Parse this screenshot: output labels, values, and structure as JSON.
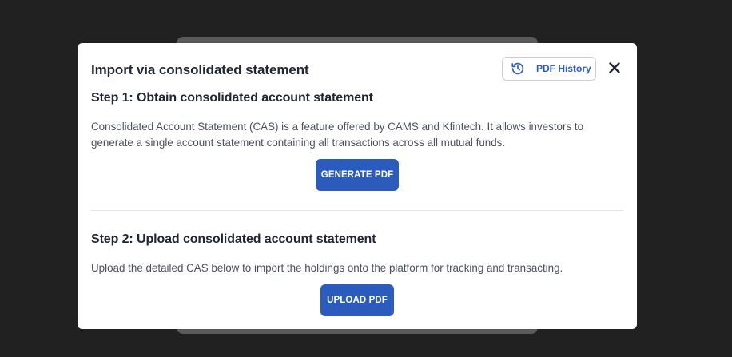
{
  "modal": {
    "title": "Import via consolidated statement",
    "history_button_label": "PDF History",
    "history_icon": "history-icon",
    "close_icon": "close-icon"
  },
  "step1": {
    "title": "Step 1: Obtain consolidated account statement",
    "description": "Consolidated Account Statement (CAS) is a feature offered by CAMS and Kfintech. It allows investors to generate a single account statement containing all transactions across all mutual funds.",
    "button_label": "GENERATE PDF"
  },
  "step2": {
    "title": "Step 2: Upload consolidated account statement",
    "description": "Upload the detailed CAS below to import the holdings onto the platform for tracking and transacting.",
    "button_label": "UPLOAD PDF"
  },
  "colors": {
    "accent": "#2a5bbd",
    "backdrop": "#212121",
    "text_primary": "#1f2533",
    "text_secondary": "#4a5060"
  }
}
